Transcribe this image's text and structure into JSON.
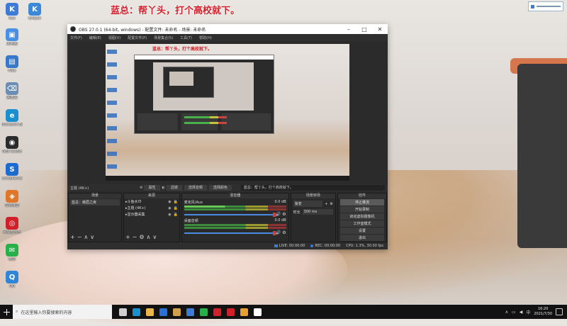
{
  "banner": {
    "text": "蓝总：帮丫头，打个高校就下。"
  },
  "desktop_icons": [
    {
      "label": "Kuo",
      "color": "#3d7bd6",
      "glyph": "K"
    },
    {
      "label": "Eclipse",
      "color": "#3b88d8",
      "glyph": "K"
    },
    {
      "label": "此电脑",
      "color": "#4a90e2",
      "glyph": "▣"
    },
    {
      "label": "Files",
      "color": "#3778c8",
      "glyph": "▤"
    },
    {
      "label": "回收站",
      "color": "#6b8db3",
      "glyph": "⌫"
    },
    {
      "label": "Microsoft Edge",
      "color": "#1a8fd0",
      "glyph": "e"
    },
    {
      "label": "OBS Studio",
      "color": "#2b2b2b",
      "glyph": "◉"
    },
    {
      "label": "Compliance Pro 4",
      "color": "#1c6bd0",
      "glyph": "S"
    },
    {
      "label": "在线课堂",
      "color": "#e0762a",
      "glyph": "◈"
    },
    {
      "label": "网易云音乐",
      "color": "#d0202a",
      "glyph": "◎"
    },
    {
      "label": "微信",
      "color": "#2ab04a",
      "glyph": "✉"
    },
    {
      "label": "QQ",
      "color": "#2f86d6",
      "glyph": "Q"
    }
  ],
  "obs": {
    "title": "OBS 27.0.1 (64-bit, windows) - 配置文件: 未命名 - 场景: 未命名",
    "menu": [
      "文件(F)",
      "编辑(E)",
      "视图(V)",
      "配置文件(P)",
      "场景集合(S)",
      "工具(T)",
      "帮助(H)"
    ],
    "preview_banner": "蓝总：帮丫头，打个高校就下。",
    "scene_bar": {
      "current": "主题 (4K+)",
      "prop_label": "属性",
      "filter_label": "滤镜",
      "btn1": "选择音频",
      "btn2": "选择颜色",
      "label2": "蓝总：帮丫头，打个高校就下。"
    },
    "docks": {
      "scenes": {
        "title": "场景",
        "items": [
          "蓝总：峨眉之疾"
        ]
      },
      "sources": {
        "title": "来源",
        "items": [
          "斗鱼水印",
          "主题 (4K+)",
          "显示器采集"
        ]
      },
      "mixer": {
        "title": "混音器",
        "channels": [
          {
            "name": "麦克风/Aux",
            "db": "0.0 dB"
          },
          {
            "name": "桌面音频",
            "db": "0.0 dB"
          }
        ]
      },
      "transitions": {
        "title": "场景转场",
        "type": "渐变",
        "duration_label": "时长",
        "duration": "300 ms"
      },
      "controls": {
        "title": "控件",
        "buttons": [
          "停止推流",
          "开始录制",
          "启动虚拟摄像机",
          "工作室模式",
          "设置",
          "退出"
        ]
      }
    },
    "status": {
      "live_label": "LIVE:",
      "live_time": "00:00:00",
      "rec_label": "REC:",
      "rec_time": "00:00:00",
      "cpu": "CPU: 1.3%, 30.00 fps"
    }
  },
  "taskbar": {
    "search_placeholder": "在这里输入你要搜索的内容",
    "apps": [
      "#cfcfcf",
      "#1a8fd0",
      "#e8b64a",
      "#2a6fd6",
      "#d0a04a",
      "#3d7bd6",
      "#2ab04a",
      "#d0202a",
      "#d0202a",
      "#e8a030",
      "#ffffff"
    ],
    "time": "16:20",
    "date": "2021/7/30"
  }
}
